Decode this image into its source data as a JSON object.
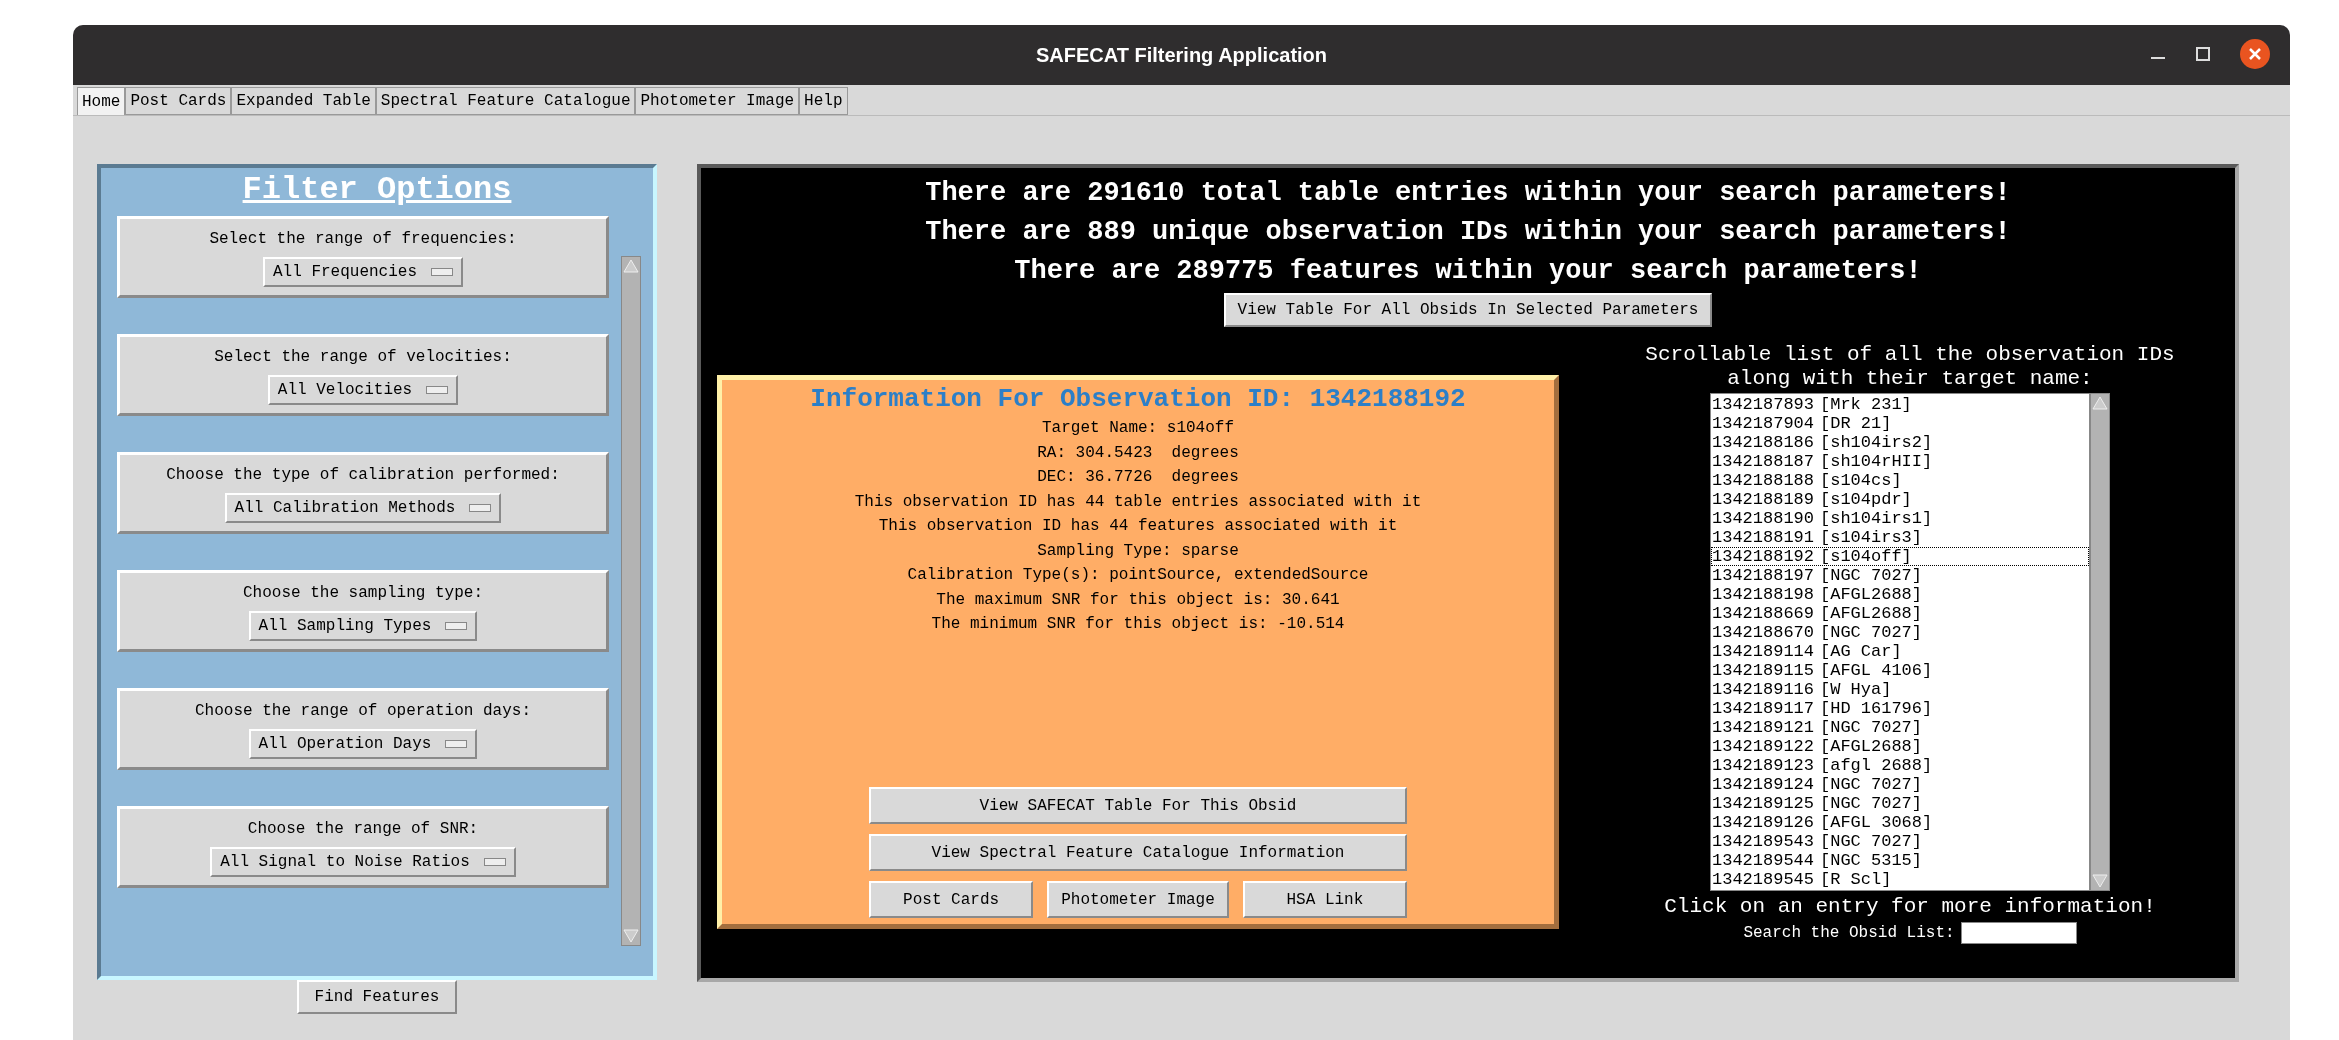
{
  "window": {
    "title": "SAFECAT Filtering Application"
  },
  "tabs": [
    {
      "label": "Home",
      "selected": true
    },
    {
      "label": "Post Cards",
      "selected": false
    },
    {
      "label": "Expanded Table",
      "selected": false
    },
    {
      "label": "Spectral Feature Catalogue",
      "selected": false
    },
    {
      "label": "Photometer Image",
      "selected": false
    },
    {
      "label": "Help",
      "selected": false
    }
  ],
  "filter_panel": {
    "title": "Filter Options",
    "groups": [
      {
        "label": "Select the range of frequencies:",
        "dropdown": "All Frequencies"
      },
      {
        "label": "Select the range of velocities:",
        "dropdown": "All Velocities"
      },
      {
        "label": "Choose the type of calibration performed:",
        "dropdown": "All Calibration Methods"
      },
      {
        "label": "Choose the sampling type:",
        "dropdown": "All Sampling Types"
      },
      {
        "label": "Choose the range of operation days:",
        "dropdown": "All Operation Days"
      },
      {
        "label": "Choose the range of SNR:",
        "dropdown": "All Signal to Noise Ratios"
      }
    ],
    "button": "Find Features"
  },
  "summary": {
    "lines": [
      "There are 291610 total table entries within your search parameters!",
      "There are 889 unique observation IDs within your search parameters!",
      "There are 289775 features within your search parameters!"
    ],
    "button": "View Table For All Obsids In Selected Parameters"
  },
  "info": {
    "title": "Information For Observation ID: 1342188192",
    "lines": [
      "Target Name: s104off",
      "RA: 304.5423  degrees",
      "DEC: 36.7726  degrees",
      "This observation ID has 44 table entries associated with it",
      "This observation ID has 44 features associated with it",
      "Sampling Type: sparse",
      "Calibration Type(s): pointSource, extendedSource",
      "The maximum SNR for this object is: 30.641",
      "The minimum SNR for this object is: -10.514"
    ],
    "button_rows": [
      [
        "View SAFECAT Table For This Obsid"
      ],
      [
        "View Spectral Feature Catalogue Information"
      ],
      [
        "Post Cards",
        "Photometer Image",
        "HSA Link"
      ]
    ]
  },
  "obsid_list": {
    "caption": [
      "Scrollable list of all the observation IDs",
      "along with their target name:"
    ],
    "items": [
      {
        "obsid": "1342187893",
        "target": "[Mrk 231]",
        "selected": false
      },
      {
        "obsid": "1342187904",
        "target": "[DR 21]",
        "selected": false
      },
      {
        "obsid": "1342188186",
        "target": "[sh104irs2]",
        "selected": false
      },
      {
        "obsid": "1342188187",
        "target": "[sh104rHII]",
        "selected": false
      },
      {
        "obsid": "1342188188",
        "target": "[s104cs]",
        "selected": false
      },
      {
        "obsid": "1342188189",
        "target": "[s104pdr]",
        "selected": false
      },
      {
        "obsid": "1342188190",
        "target": "[sh104irs1]",
        "selected": false
      },
      {
        "obsid": "1342188191",
        "target": "[s104irs3]",
        "selected": false
      },
      {
        "obsid": "1342188192",
        "target": "[s104off]",
        "selected": true
      },
      {
        "obsid": "1342188197",
        "target": "[NGC 7027]",
        "selected": false
      },
      {
        "obsid": "1342188198",
        "target": "[AFGL2688]",
        "selected": false
      },
      {
        "obsid": "1342188669",
        "target": "[AFGL2688]",
        "selected": false
      },
      {
        "obsid": "1342188670",
        "target": "[NGC 7027]",
        "selected": false
      },
      {
        "obsid": "1342189114",
        "target": "[AG Car]",
        "selected": false
      },
      {
        "obsid": "1342189115",
        "target": "[AFGL 4106]",
        "selected": false
      },
      {
        "obsid": "1342189116",
        "target": "[W Hya]",
        "selected": false
      },
      {
        "obsid": "1342189117",
        "target": "[HD 161796]",
        "selected": false
      },
      {
        "obsid": "1342189121",
        "target": "[NGC 7027]",
        "selected": false
      },
      {
        "obsid": "1342189122",
        "target": "[AFGL2688]",
        "selected": false
      },
      {
        "obsid": "1342189123",
        "target": "[afgl 2688]",
        "selected": false
      },
      {
        "obsid": "1342189124",
        "target": "[NGC 7027]",
        "selected": false
      },
      {
        "obsid": "1342189125",
        "target": "[NGC 7027]",
        "selected": false
      },
      {
        "obsid": "1342189126",
        "target": "[AFGL 3068]",
        "selected": false
      },
      {
        "obsid": "1342189543",
        "target": "[NGC 7027]",
        "selected": false
      },
      {
        "obsid": "1342189544",
        "target": "[NGC 5315]",
        "selected": false
      },
      {
        "obsid": "1342189545",
        "target": "[R Scl]",
        "selected": false
      }
    ],
    "footer": "Click on an entry for more information!",
    "search_label": "Search the Obsid List:"
  }
}
